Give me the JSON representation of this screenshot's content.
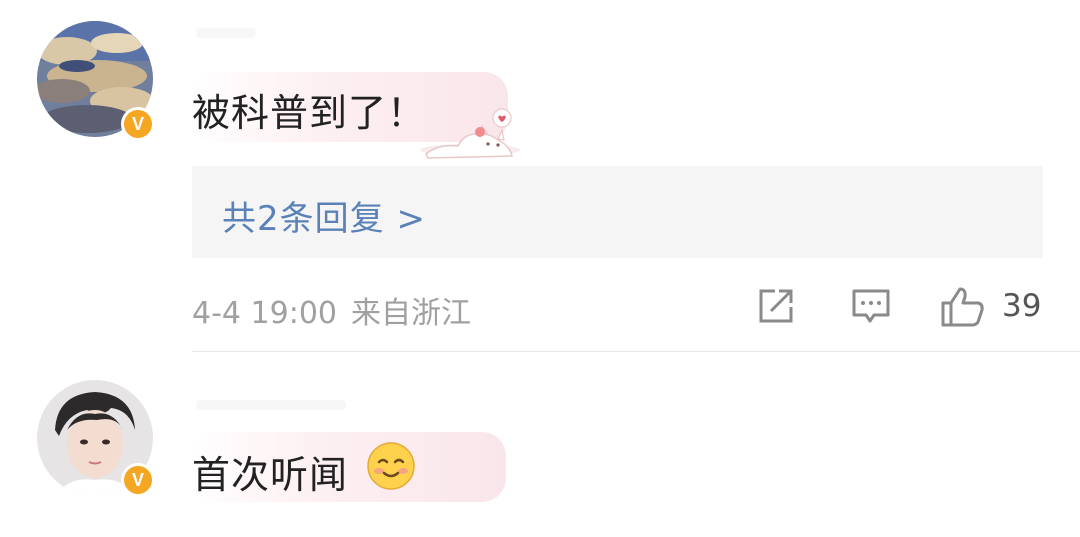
{
  "comments": [
    {
      "text": "被科普到了！",
      "verified_badge": "V",
      "avatar": "cloudy-sky-avatar",
      "sticker": "cat-sticker",
      "replies_label": "共2条回复 >",
      "timestamp": "4-4 19:00",
      "location": "来自浙江",
      "like_count": "39",
      "actions": [
        "share-icon",
        "comment-icon",
        "like-icon"
      ]
    },
    {
      "text": "首次听闻",
      "verified_badge": "V",
      "avatar": "person-avatar",
      "emoji": "smiling-face"
    }
  ],
  "colors": {
    "link_blue": "#5a82b8",
    "badge_orange": "#f5a623",
    "meta_gray": "#a0a0a0",
    "replies_bg": "#f5f5f5"
  }
}
